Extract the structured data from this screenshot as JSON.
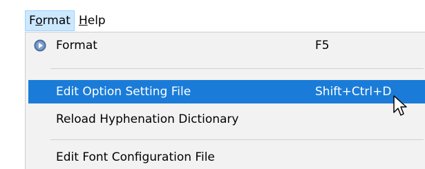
{
  "menubar": {
    "format": {
      "label_pre": "F",
      "label_mnemonic": "o",
      "label_post": "rmat"
    },
    "help": {
      "label_mnemonic": "H",
      "label_post": "elp"
    }
  },
  "menu": {
    "items": [
      {
        "label": "Format",
        "shortcut": "F5",
        "icon": "play-icon"
      },
      {
        "label": "Edit Option Setting File",
        "shortcut": "Shift+Ctrl+D",
        "highlighted": true
      },
      {
        "label": "Reload Hyphenation Dictionary"
      },
      {
        "label": "Edit Font Configuration File"
      }
    ]
  },
  "colors": {
    "highlight": "#1a7cd8",
    "menubar_active": "#cce8ff",
    "menu_background": "#f2f2f2"
  }
}
